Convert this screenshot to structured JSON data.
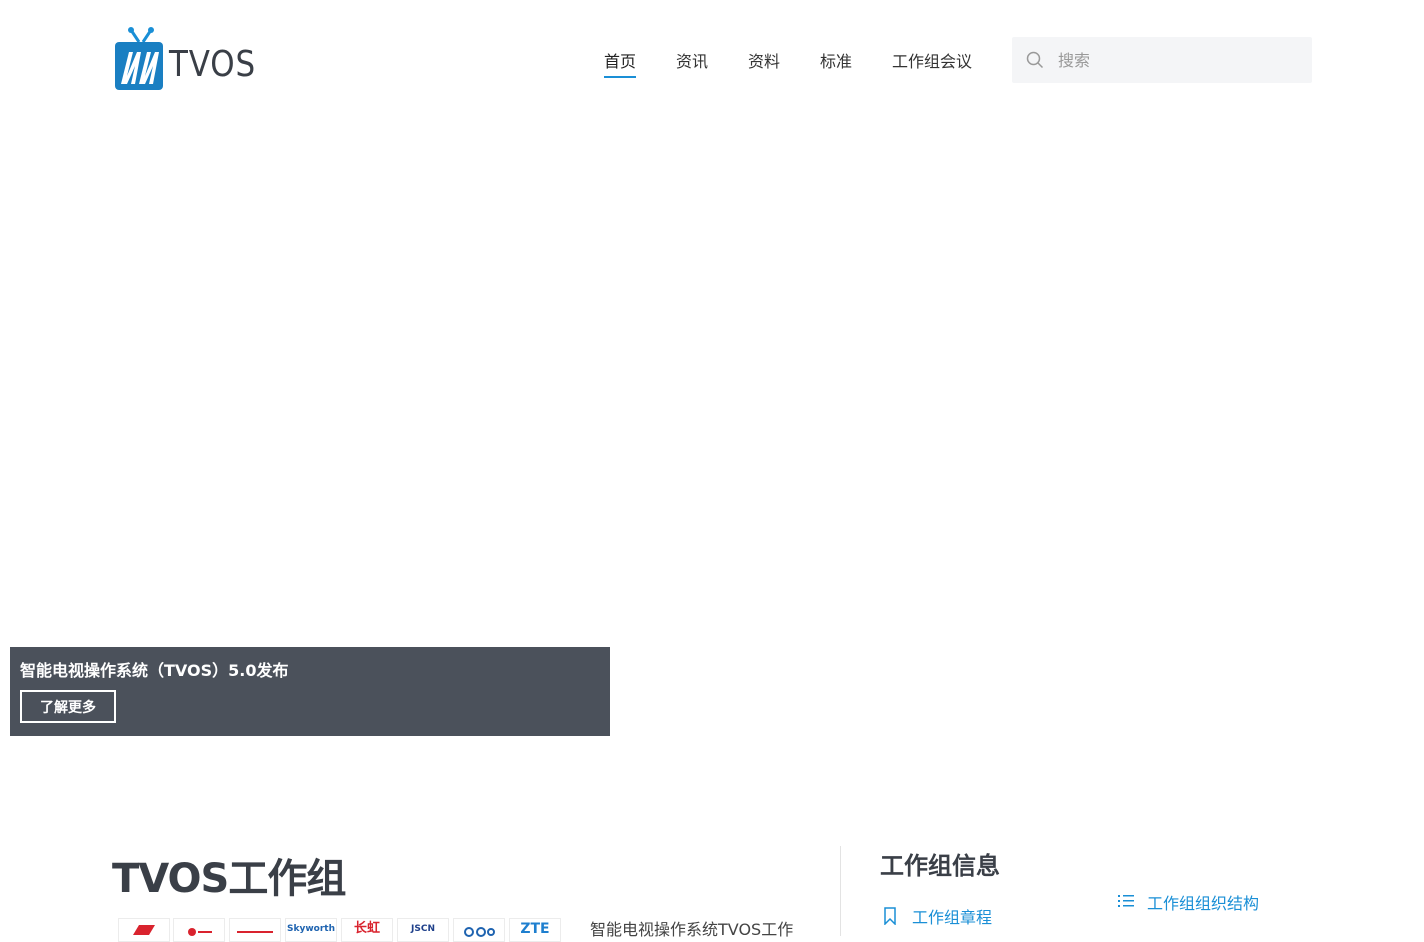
{
  "header": {
    "logo_text": "TVOS",
    "nav": [
      {
        "label": "首页",
        "active": true
      },
      {
        "label": "资讯",
        "active": false
      },
      {
        "label": "资料",
        "active": false
      },
      {
        "label": "标准",
        "active": false
      },
      {
        "label": "工作组会议",
        "active": false
      }
    ],
    "search": {
      "placeholder": "搜索",
      "value": ""
    }
  },
  "banner": {
    "caption_title": "智能电视操作系统（TVOS）5.0发布",
    "caption_button": "了解更多"
  },
  "workgroup": {
    "title": "TVOS工作组",
    "intro_text": "智能电视操作系统TVOS工作",
    "partners": [
      "",
      "",
      "",
      "Skyworth",
      "长虹",
      "JSCN",
      "",
      "ZTE"
    ]
  },
  "info": {
    "title": "工作组信息",
    "links": [
      "工作组章程",
      "工作组组织结构"
    ]
  },
  "colors": {
    "accent": "#1a8fd6",
    "caption_bg": "#4b515b",
    "heading": "#3a3f47"
  }
}
